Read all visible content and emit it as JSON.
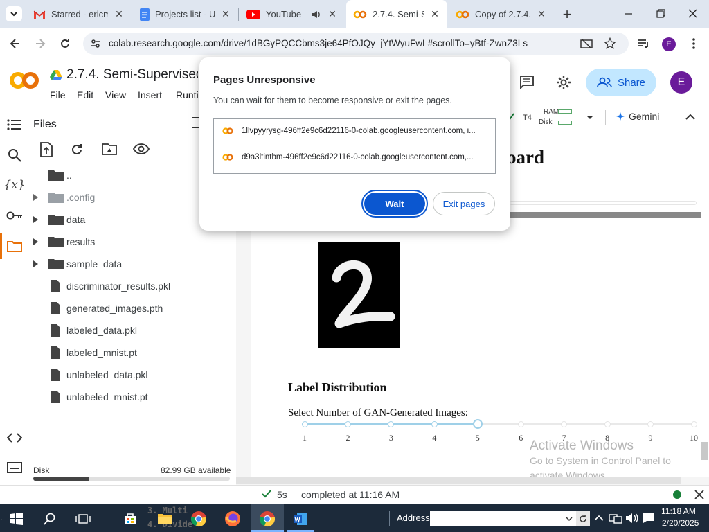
{
  "browser": {
    "tabs": [
      {
        "title": "Starred - ericm…",
        "icon": "gmail-icon"
      },
      {
        "title": "Projects list - U…",
        "icon": "docs-icon"
      },
      {
        "title": "YouTube",
        "icon": "youtube-icon"
      },
      {
        "title": "2.7.4. Semi-Sup",
        "icon": "colab-icon"
      },
      {
        "title": "Copy of 2.7.4. S",
        "icon": "colab-icon"
      }
    ],
    "url": "colab.research.google.com/drive/1dBGyPQCCbms3je64PfOJQy_jYtWyuFwL#scrollTo=yBtf-ZwnZ3Ls",
    "profile_initial": "E"
  },
  "colab": {
    "notebook_title": "2.7.4. Semi-Supervised G",
    "menu": [
      "File",
      "Edit",
      "View",
      "Insert",
      "Runti"
    ],
    "share_label": "Share",
    "profile_initial": "E",
    "runtime": {
      "type": "T4",
      "ram": "RAM",
      "disk": "Disk"
    },
    "gemini_label": "Gemini"
  },
  "files_panel": {
    "title": "Files",
    "items": [
      {
        "name": "..",
        "type": "folder-up"
      },
      {
        "name": ".config",
        "type": "folder"
      },
      {
        "name": "data",
        "type": "folder"
      },
      {
        "name": "results",
        "type": "folder"
      },
      {
        "name": "sample_data",
        "type": "folder"
      },
      {
        "name": "discriminator_results.pkl",
        "type": "file"
      },
      {
        "name": "generated_images.pth",
        "type": "file"
      },
      {
        "name": "labeled_data.pkl",
        "type": "file"
      },
      {
        "name": "labeled_mnist.pt",
        "type": "file"
      },
      {
        "name": "unlabeled_data.pkl",
        "type": "file"
      },
      {
        "name": "unlabeled_mnist.pt",
        "type": "file"
      }
    ],
    "disk_label": "Disk",
    "disk_available": "82.99 GB available",
    "disk_used_fraction": 0.28
  },
  "dialog": {
    "title": "Pages Unresponsive",
    "message": "You can wait for them to become responsive or exit the pages.",
    "pages": [
      "1llvpyyrysg-496ff2e9c6d22116-0-colab.googleusercontent.com, i...",
      "d9a3ltintbm-496ff2e9c6d22116-0-colab.googleusercontent.com,..."
    ],
    "wait_label": "Wait",
    "exit_label": "Exit pages"
  },
  "output": {
    "heading_fragment": "oard",
    "label_distribution_heading": "Label Distribution",
    "slider_label": "Select Number of GAN-Generated Images:",
    "slider_ticks": [
      "1",
      "2",
      "3",
      "4",
      "5",
      "6",
      "7",
      "8",
      "9",
      "10"
    ],
    "slider_value": 5,
    "digit_shown": "2"
  },
  "watermark": {
    "line1": "Activate Windows",
    "line2": "Go to System in Control Panel to",
    "line3": "activate Windows."
  },
  "status_bar": {
    "duration": "5s",
    "completed": "completed at 11:16 AM"
  },
  "taskbar": {
    "address_label": "Address",
    "time": "11:18 AM",
    "date": "2/20/2025",
    "background_text": [
      "3. Multi",
      "4. Divide"
    ]
  },
  "colors": {
    "colab_orange": "#f9ab00",
    "accent_blue": "#0b57d0",
    "share_bg": "#c2e7ff",
    "profile_purple": "#6a1b9a",
    "slider_fill": "#9fd0e8"
  }
}
